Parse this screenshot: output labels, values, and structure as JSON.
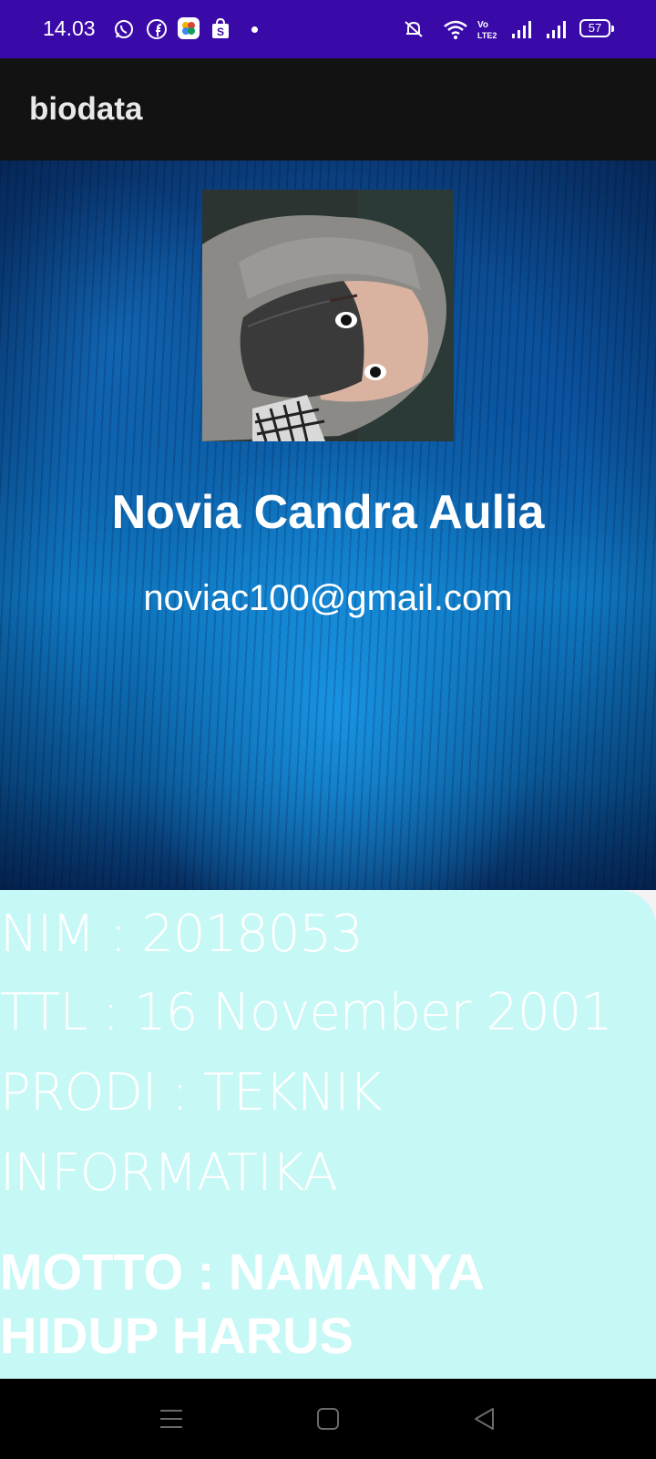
{
  "status_bar": {
    "time": "14.03",
    "battery": "57",
    "icons": [
      "whatsapp-icon",
      "facebook-icon",
      "photos-icon",
      "shopee-icon",
      "notification-dot",
      "mute-icon",
      "wifi-icon",
      "volte-icon",
      "signal-icon",
      "signal-icon",
      "battery-icon"
    ]
  },
  "app_bar": {
    "title": "biodata"
  },
  "profile": {
    "name": "Novia Candra Aulia",
    "email": "noviac100@gmail.com"
  },
  "info": {
    "nim": "NIM : 2018053",
    "ttl": "TTL : 16 November 2001",
    "prodi_line1": "PRODI : TEKNIK",
    "prodi_line2": "INFORMATIKA",
    "motto": "MOTTO : NAMANYA HIDUP HARUS DIPERJUANGKAN"
  },
  "nav_bar": {
    "buttons": [
      "recents-icon",
      "home-icon",
      "back-icon"
    ]
  },
  "colors": {
    "status_bar": "#3a0aa8",
    "app_bar": "#121212",
    "info_card": "#c6f8f6",
    "nav_bar": "#000000"
  }
}
